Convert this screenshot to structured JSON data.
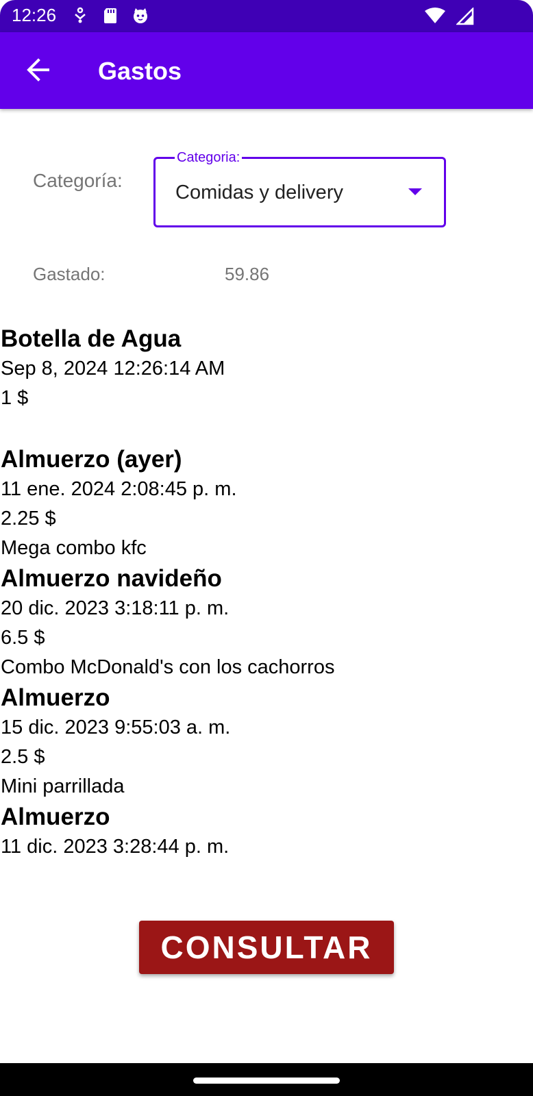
{
  "status_bar": {
    "time": "12:26",
    "left_icons": [
      "usb-debug-icon",
      "sd-card-icon",
      "cat-notification-icon"
    ],
    "right_icons": [
      "wifi-icon",
      "signal-icon"
    ]
  },
  "app_bar": {
    "title": "Gastos",
    "back_icon": "arrow-left-icon"
  },
  "filter": {
    "label": "Categoría:",
    "dropdown_float_label": "Categoria:",
    "selected": "Comidas y delivery",
    "accent_color": "#6200ea"
  },
  "summary": {
    "label": "Gastado:",
    "value": "59.86"
  },
  "expenses": [
    {
      "title": "Botella de Agua",
      "date": "Sep 8, 2024 12:26:14 AM",
      "amount": "1 $",
      "note": ""
    },
    {
      "title": "Almuerzo (ayer)",
      "date": "11 ene. 2024 2:08:45 p. m.",
      "amount": "2.25 $",
      "note": "Mega combo kfc"
    },
    {
      "title": "Almuerzo navideño",
      "date": "20 dic. 2023 3:18:11 p. m.",
      "amount": "6.5 $",
      "note": "Combo McDonald's con los cachorros"
    },
    {
      "title": "Almuerzo",
      "date": "15 dic. 2023 9:55:03 a. m.",
      "amount": "2.5 $",
      "note": "Mini parrillada"
    },
    {
      "title": "Almuerzo",
      "date": "11 dic. 2023 3:28:44 p. m.",
      "amount": "",
      "note": ""
    }
  ],
  "actions": {
    "consultar_label": "CONSULTAR",
    "consultar_color": "#9b1616"
  },
  "colors": {
    "status_bar": "#3f00b5",
    "app_bar": "#6200ea"
  }
}
